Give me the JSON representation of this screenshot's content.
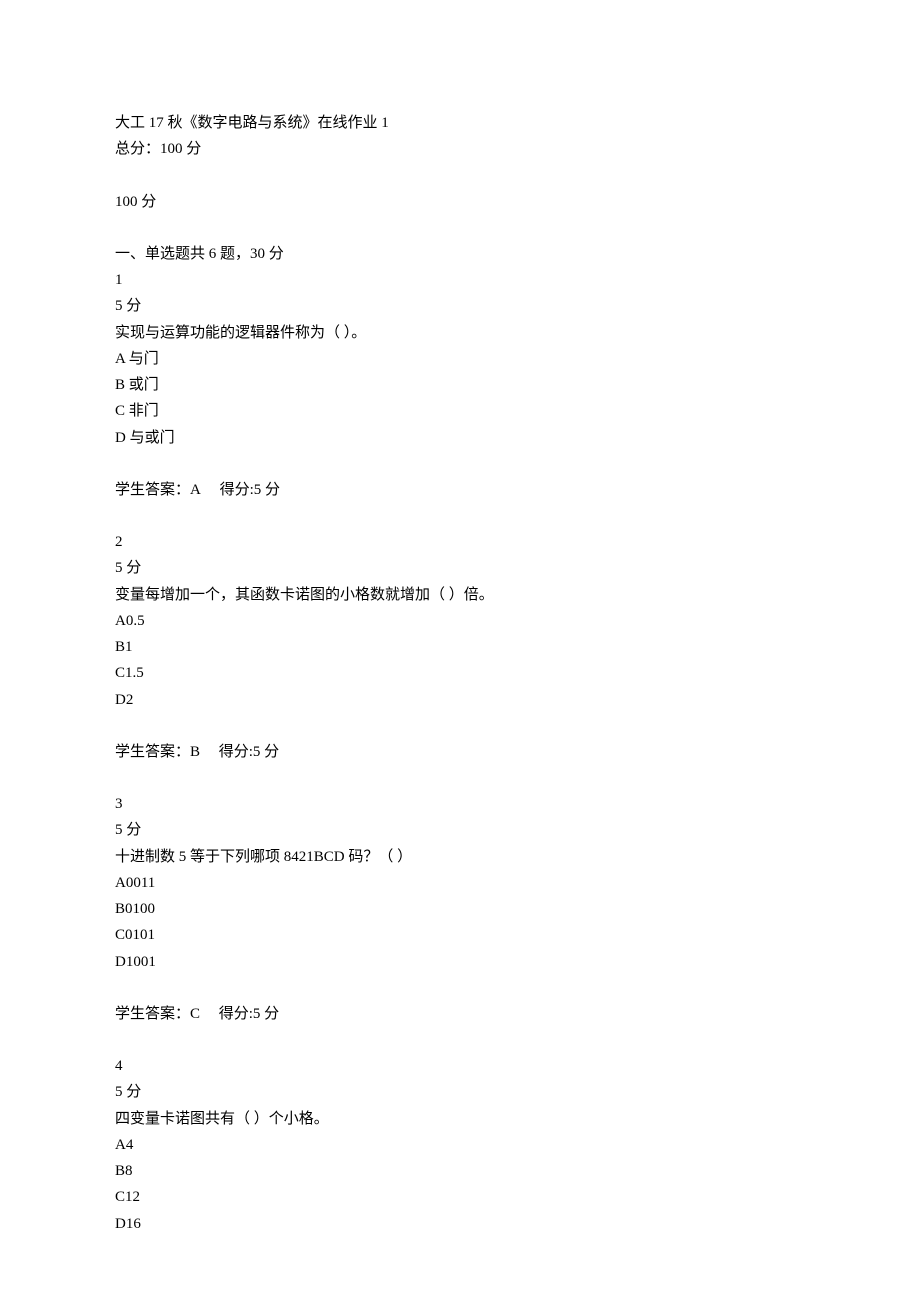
{
  "header": {
    "course_title": "大工 17 秋《数字电路与系统》在线作业 1",
    "total_label": "总分：100 分",
    "score": "100 分"
  },
  "section": {
    "heading": "一、单选题共 6 题，30 分"
  },
  "questions": [
    {
      "num": "1",
      "points": "5 分",
      "stem": "实现与运算功能的逻辑器件称为（ ）。",
      "options": [
        "A 与门",
        "B 或门",
        "C 非门",
        "D 与或门"
      ],
      "answer": "学生答案：A  得分:5 分"
    },
    {
      "num": "2",
      "points": "5 分",
      "stem": "变量每增加一个，其函数卡诺图的小格数就增加（ ）倍。",
      "options": [
        "A0.5",
        "B1",
        "C1.5",
        "D2"
      ],
      "answer": "学生答案：B  得分:5 分"
    },
    {
      "num": "3",
      "points": "5 分",
      "stem": "十进制数 5 等于下列哪项 8421BCD 码？（ ）",
      "options": [
        "A0011",
        "B0100",
        "C0101",
        "D1001"
      ],
      "answer": "学生答案：C  得分:5 分"
    },
    {
      "num": "4",
      "points": "5 分",
      "stem": "四变量卡诺图共有（ ）个小格。",
      "options": [
        "A4",
        "B8",
        "C12",
        "D16"
      ],
      "answer": null
    }
  ]
}
